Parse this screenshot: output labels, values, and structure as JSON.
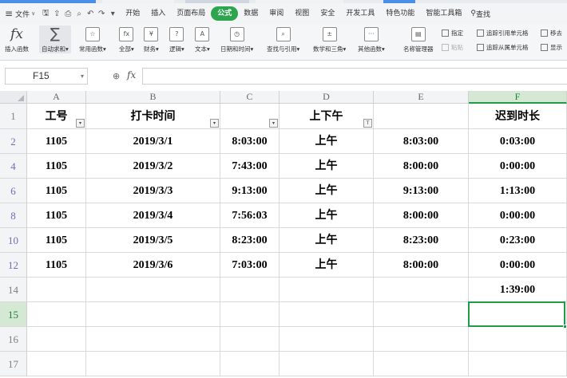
{
  "menubar": {
    "file_label": "文件",
    "tabs": [
      "开始",
      "插入",
      "页面布局",
      "公式",
      "数据",
      "审阅",
      "视图",
      "安全",
      "开发工具",
      "特色功能",
      "智能工具箱"
    ],
    "active_tab": "公式",
    "search_label": "查找"
  },
  "ribbon": {
    "insert_function": "插入函数",
    "autosum": "自动求和",
    "common_functions": "常用函数",
    "all": "全部",
    "financial": "财务",
    "logical": "逻辑",
    "text": "文本",
    "datetime": "日期和时间",
    "lookup": "查找与引用",
    "math": "数学和三角",
    "other": "其他函数",
    "name_manager": "名称管理器",
    "define": "指定",
    "paste": "粘贴",
    "trace_precedents": "追踪引用单元格",
    "trace_dependents": "追踪从属单元格",
    "remove_arrows": "移去",
    "show": "显示"
  },
  "formula_bar": {
    "name_box": "F15",
    "fx": "fx",
    "value": ""
  },
  "sheet": {
    "columns": [
      "A",
      "B",
      "C",
      "D",
      "E",
      "F"
    ],
    "selected_column": "F",
    "header_row": {
      "row_number": "1",
      "cells": [
        "工号",
        "打卡时间",
        "",
        "上下午",
        "",
        "迟到时长"
      ]
    },
    "data_rows": [
      {
        "row_number": "2",
        "cells": [
          "1105",
          "2019/3/1",
          "8:03:00",
          "上午",
          "8:03:00",
          "0:03:00"
        ]
      },
      {
        "row_number": "4",
        "cells": [
          "1105",
          "2019/3/2",
          "7:43:00",
          "上午",
          "8:00:00",
          "0:00:00"
        ]
      },
      {
        "row_number": "6",
        "cells": [
          "1105",
          "2019/3/3",
          "9:13:00",
          "上午",
          "9:13:00",
          "1:13:00"
        ]
      },
      {
        "row_number": "8",
        "cells": [
          "1105",
          "2019/3/4",
          "7:56:03",
          "上午",
          "8:00:00",
          "0:00:00"
        ]
      },
      {
        "row_number": "10",
        "cells": [
          "1105",
          "2019/3/5",
          "8:23:00",
          "上午",
          "8:23:00",
          "0:23:00"
        ]
      },
      {
        "row_number": "12",
        "cells": [
          "1105",
          "2019/3/6",
          "7:03:00",
          "上午",
          "8:00:00",
          "0:00:00"
        ]
      },
      {
        "row_number": "14",
        "cells": [
          "",
          "",
          "",
          "",
          "",
          "1:39:00"
        ]
      },
      {
        "row_number": "15",
        "cells": [
          "",
          "",
          "",
          "",
          "",
          ""
        ]
      },
      {
        "row_number": "16",
        "cells": [
          "",
          "",
          "",
          "",
          "",
          ""
        ]
      },
      {
        "row_number": "17",
        "cells": [
          "",
          "",
          "",
          "",
          "",
          ""
        ]
      }
    ],
    "selected_cell": "F15",
    "colors": {
      "accent": "#1e9c48",
      "active_tab": "#2da44e",
      "filtered_row_number": "#6a6fb8"
    }
  }
}
